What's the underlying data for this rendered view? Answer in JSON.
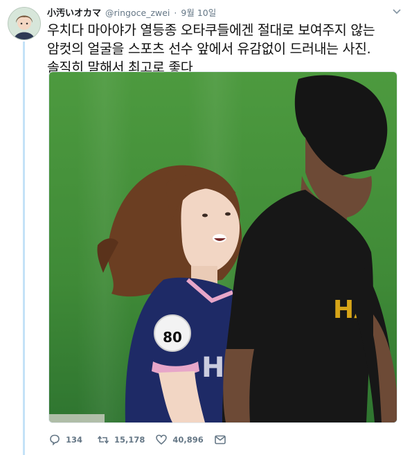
{
  "tweet": {
    "display_name": "小汚いオカマ",
    "handle": "@ringoce_zwei",
    "separator": "·",
    "date": "9월 10일",
    "text": "우치다 마아야가 열등종 오타쿠들에겐 절대로 보여주지 않는\n암컷의 얼굴을 스포츠 선수 앞에서 유감없이 드러내는 사진.\n솔직히 말해서 최고로 좋다",
    "photo_jersey_number": "80"
  },
  "actions": {
    "replies": "134",
    "retweets": "15,178",
    "likes": "40,896"
  },
  "icons": {
    "reply": "reply-icon",
    "retweet": "retweet-icon",
    "like": "heart-icon",
    "message": "direct-message-icon",
    "caret": "chevron-down-icon"
  },
  "colors": {
    "thread_line": "#c4e2f7",
    "secondary_text": "#657786",
    "field_green": "#3f8a37"
  }
}
